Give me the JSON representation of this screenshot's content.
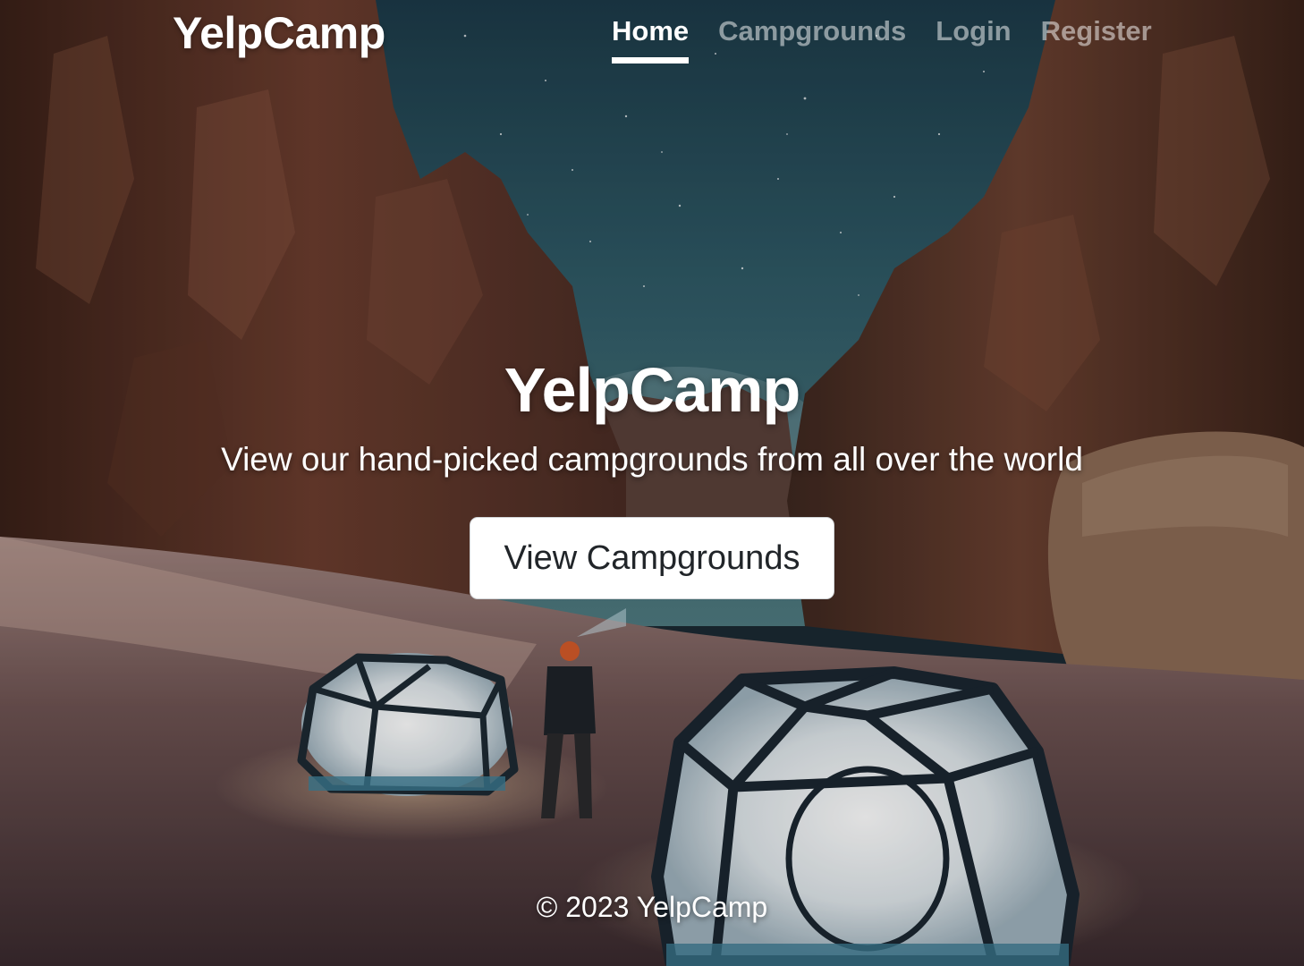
{
  "navbar": {
    "brand": "YelpCamp",
    "links": [
      {
        "label": "Home",
        "active": true
      },
      {
        "label": "Campgrounds",
        "active": false
      },
      {
        "label": "Login",
        "active": false
      },
      {
        "label": "Register",
        "active": false
      }
    ]
  },
  "hero": {
    "title": "YelpCamp",
    "lead": "View our hand-picked campgrounds from all over the world",
    "cta_label": "View Campgrounds"
  },
  "footer": {
    "text": "© 2023 YelpCamp"
  },
  "colors": {
    "text": "#ffffff",
    "nav_inactive": "rgba(255,255,255,0.5)",
    "button_bg": "#ffffff",
    "button_text": "#212529"
  }
}
